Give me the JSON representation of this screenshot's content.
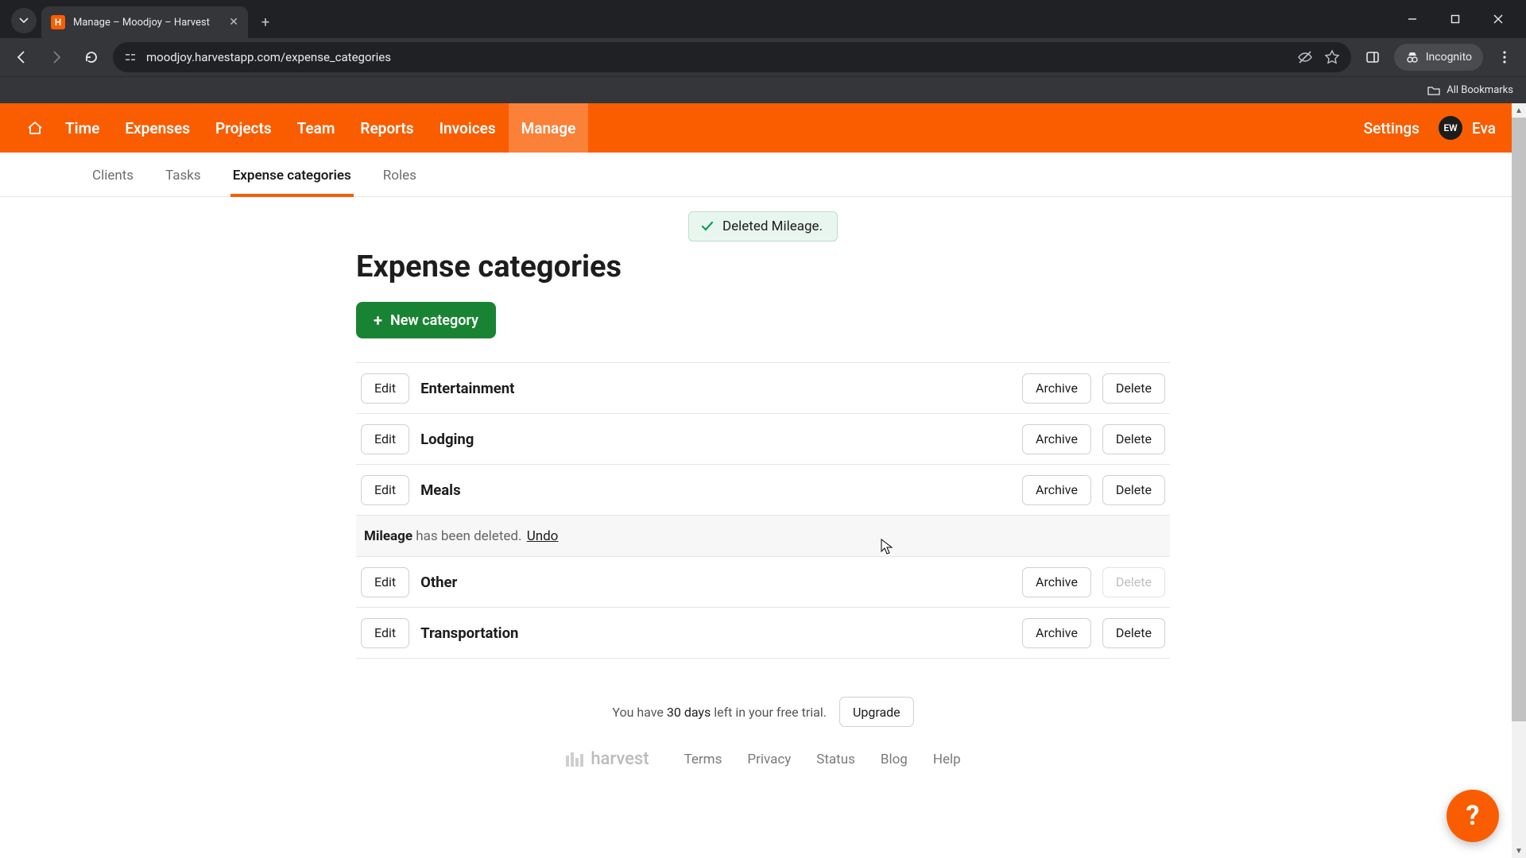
{
  "browser": {
    "tab_title": "Manage – Moodjoy – Harvest",
    "url": "moodjoy.harvestapp.com/expense_categories",
    "incognito_label": "Incognito",
    "all_bookmarks": "All Bookmarks"
  },
  "nav": {
    "items": [
      "Time",
      "Expenses",
      "Projects",
      "Team",
      "Reports",
      "Invoices",
      "Manage"
    ],
    "active": "Manage",
    "settings": "Settings",
    "user_initials": "EW",
    "user_name": "Eva"
  },
  "subnav": {
    "items": [
      "Clients",
      "Tasks",
      "Expense categories",
      "Roles"
    ],
    "active": "Expense categories"
  },
  "toast": {
    "text": "Deleted Mileage."
  },
  "page": {
    "title": "Expense categories",
    "new_button": "New category",
    "edit_label": "Edit",
    "archive_label": "Archive",
    "delete_label": "Delete",
    "undo_label": "Undo",
    "deleted_suffix": "has been deleted.",
    "categories": [
      {
        "name": "Entertainment",
        "delete_disabled": false
      },
      {
        "name": "Lodging",
        "delete_disabled": false
      },
      {
        "name": "Meals",
        "delete_disabled": false
      }
    ],
    "deleted_row": {
      "name": "Mileage"
    },
    "categories_after": [
      {
        "name": "Other",
        "delete_disabled": true
      },
      {
        "name": "Transportation",
        "delete_disabled": false
      }
    ]
  },
  "trial": {
    "prefix": "You have ",
    "days": "30 days",
    "suffix": " left in your free trial.",
    "upgrade": "Upgrade"
  },
  "footer": {
    "brand": "harvest",
    "links": [
      "Terms",
      "Privacy",
      "Status",
      "Blog",
      "Help"
    ]
  }
}
